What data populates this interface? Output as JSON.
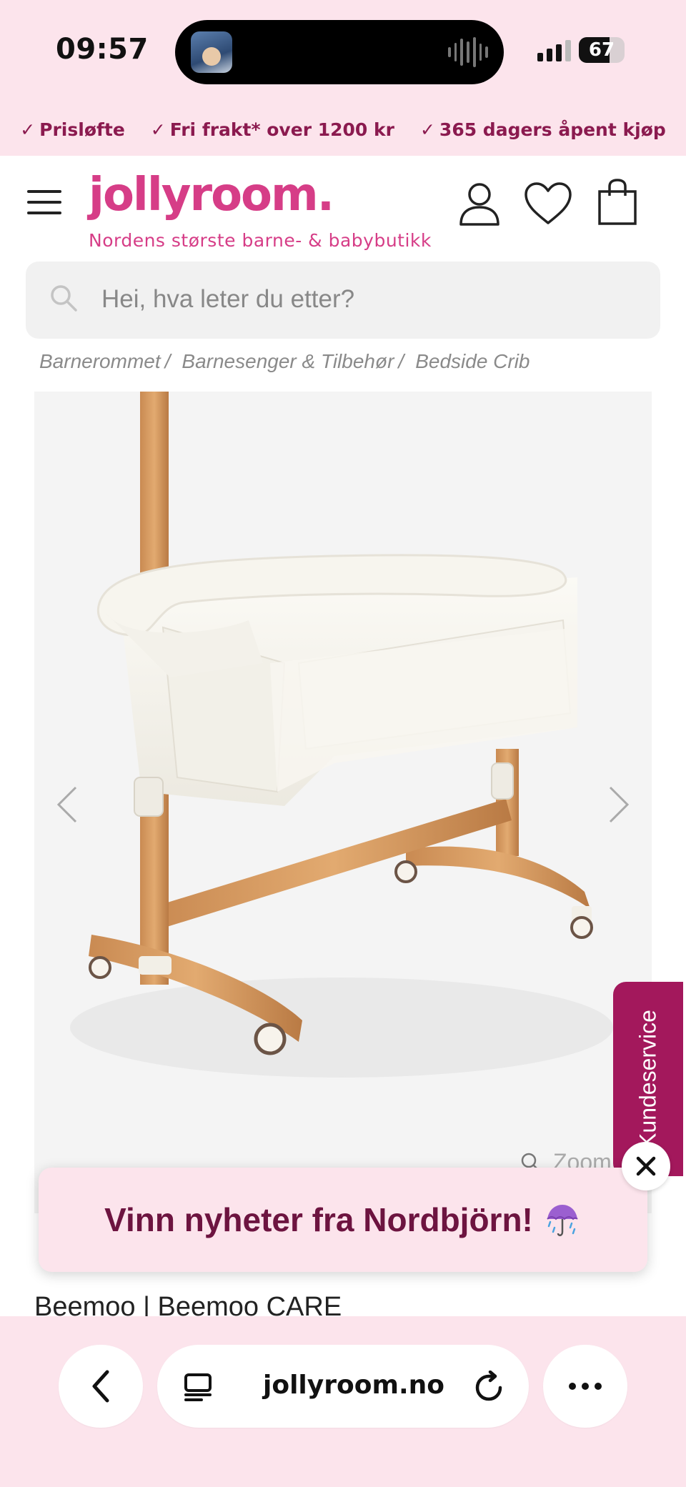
{
  "status_bar": {
    "time": "09:57",
    "battery": "67"
  },
  "usp_bar": {
    "items": [
      "Prisløfte",
      "Fri frakt* over 1200 kr",
      "365 dagers åpent kjøp"
    ],
    "check_glyph": "✓"
  },
  "header": {
    "logo": "jollyroom.",
    "tagline": "Nordens største barne- & babybutikk",
    "brand_color": "#d63d87"
  },
  "search": {
    "placeholder": "Hei, hva leter du etter?"
  },
  "breadcrumb": {
    "items": [
      "Barnerommet",
      "Barnesenger & Tilbehør",
      "Bedside Crib"
    ],
    "separator": "/"
  },
  "gallery": {
    "zoom_label": "Zoom"
  },
  "customer_service": {
    "label": "Kundeservice",
    "color": "#a3185c"
  },
  "promo": {
    "text": "Vinn nyheter fra Nordbjörn!",
    "icon": "umbrella-with-rain-icon"
  },
  "product": {
    "title": "Beemoo | Beemoo CARE"
  },
  "browser": {
    "url": "jollyroom.no"
  }
}
